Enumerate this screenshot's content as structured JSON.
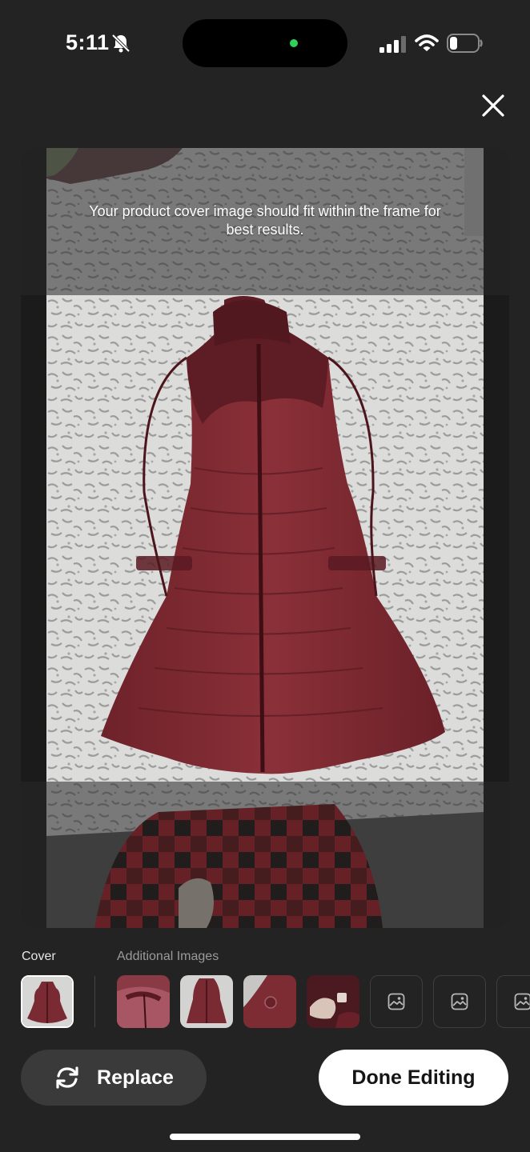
{
  "status_bar": {
    "time": "5:11"
  },
  "editor": {
    "hint": "Your product cover image should fit within the frame for best results.",
    "cover_label": "Cover",
    "additional_label": "Additional Images"
  },
  "thumbnails": {
    "cover": {
      "subject": "vest-front"
    },
    "additional": [
      {
        "subject": "vest-collar-closeup"
      },
      {
        "subject": "vest-front"
      },
      {
        "subject": "logo-closeup"
      },
      {
        "subject": "tag-closeup"
      },
      {
        "subject": "empty-slot"
      },
      {
        "subject": "empty-slot"
      },
      {
        "subject": "empty-slot"
      }
    ]
  },
  "buttons": {
    "replace_label": "Replace",
    "done_label": "Done Editing"
  },
  "colors": {
    "background": "#232323",
    "vest": "#7a2a32",
    "bedspread": "#d9d9d8",
    "button_dark": "#3a3a3a",
    "button_light": "#ffffff",
    "status_green": "#2fd158"
  },
  "icons": [
    "bell-slash-icon",
    "signal-icon",
    "wifi-icon",
    "battery-icon",
    "close-icon",
    "refresh-icon",
    "image-placeholder-icon"
  ]
}
